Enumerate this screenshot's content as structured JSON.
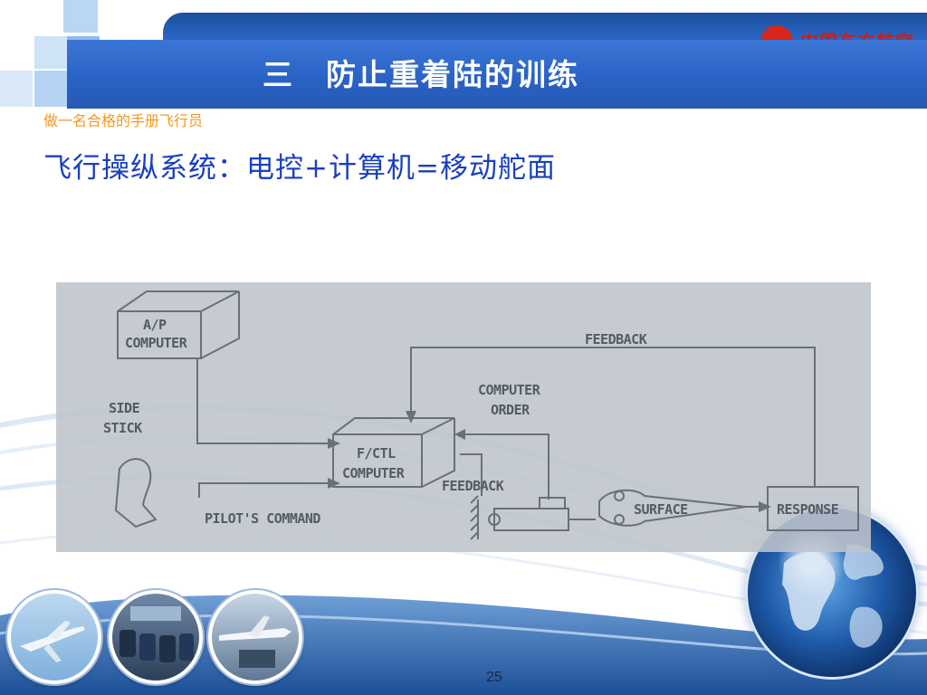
{
  "header": {
    "title": "三　防止重着陆的训练",
    "logo_text": "中国东方航空"
  },
  "subtitle": "做一名合格的手册飞行员",
  "heading": "飞行操纵系统：电控+计算机=移动舵面",
  "diagram": {
    "ap_computer_line1": "A/P",
    "ap_computer_line2": "COMPUTER",
    "feedback_top": "FEEDBACK",
    "side_stick_line1": "SIDE",
    "side_stick_line2": "STICK",
    "computer_order_line1": "COMPUTER",
    "computer_order_line2": "ORDER",
    "fctl_line1": "F/CTL",
    "fctl_line2": "COMPUTER",
    "feedback_lower": "FEEDBACK",
    "pilots_command": "PILOT'S COMMAND",
    "surface": "SURFACE",
    "response": "RESPONSE"
  },
  "footer": {
    "page_number": "25"
  }
}
